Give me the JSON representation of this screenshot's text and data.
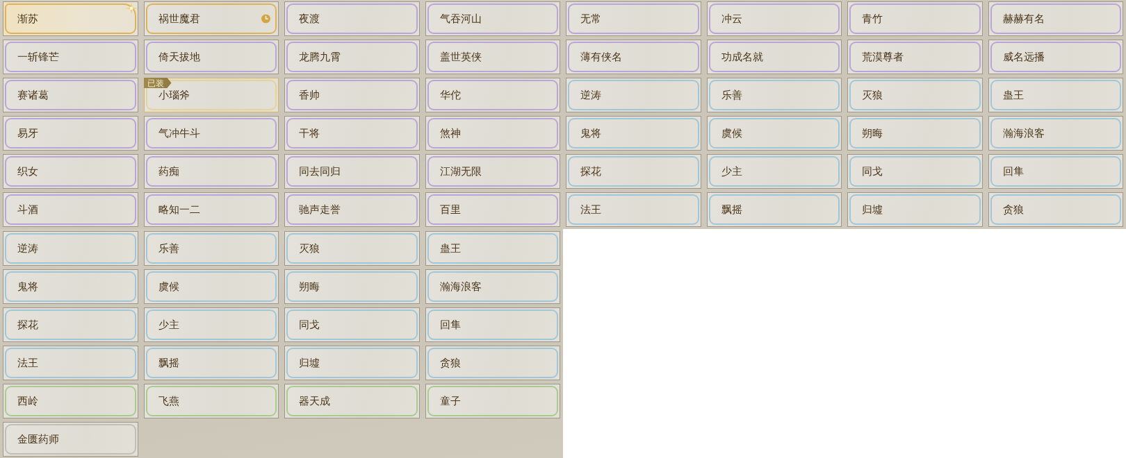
{
  "top_grid": {
    "titles": [
      {
        "name": "渐苏",
        "color": "#dfb25a",
        "kind": "special",
        "equipped": false
      },
      {
        "name": "祸世魔君",
        "color": "#dfb25a",
        "kind": "timed",
        "equipped": false
      },
      {
        "name": "夜渡",
        "color": "#b9a5d9",
        "kind": "plain",
        "equipped": false
      },
      {
        "name": "气吞河山",
        "color": "#b9a5d9",
        "kind": "plain",
        "equipped": false
      },
      {
        "name": "无常",
        "color": "#b9a5d9",
        "kind": "plain",
        "equipped": false
      },
      {
        "name": "冲云",
        "color": "#b9a5d9",
        "kind": "plain",
        "equipped": false
      },
      {
        "name": "青竹",
        "color": "#b9a5d9",
        "kind": "plain",
        "equipped": false
      },
      {
        "name": "赫赫有名",
        "color": "#b9a5d9",
        "kind": "plain",
        "equipped": false
      },
      {
        "name": "一斩锋芒",
        "color": "#b9a5d9",
        "kind": "plain",
        "equipped": false
      },
      {
        "name": "倚天拔地",
        "color": "#b9a5d9",
        "kind": "plain",
        "equipped": false
      },
      {
        "name": "龙腾九霄",
        "color": "#b9a5d9",
        "kind": "plain",
        "equipped": false
      },
      {
        "name": "盖世英侠",
        "color": "#b9a5d9",
        "kind": "plain",
        "equipped": false
      },
      {
        "name": "薄有侠名",
        "color": "#b9a5d9",
        "kind": "plain",
        "equipped": false
      },
      {
        "name": "功成名就",
        "color": "#b9a5d9",
        "kind": "plain",
        "equipped": false
      },
      {
        "name": "荒漠尊者",
        "color": "#b9a5d9",
        "kind": "plain",
        "equipped": false
      },
      {
        "name": "威名远播",
        "color": "#b9a5d9",
        "kind": "plain",
        "equipped": false
      },
      {
        "name": "赛诸葛",
        "color": "#b9a5d9",
        "kind": "plain",
        "equipped": false
      },
      {
        "name": "小瑙斧",
        "color": "#e6d398",
        "kind": "plain",
        "equipped": true,
        "badge": "已装"
      },
      {
        "name": "香帅",
        "color": "#b9a5d9",
        "kind": "plain",
        "equipped": false
      },
      {
        "name": "华佗",
        "color": "#b9a5d9",
        "kind": "plain",
        "equipped": false
      },
      {
        "name": "逆涛",
        "color": "#9fc7d9",
        "kind": "plain",
        "equipped": false
      },
      {
        "name": "乐善",
        "color": "#9fc7d9",
        "kind": "plain",
        "equipped": false
      },
      {
        "name": "灭狼",
        "color": "#9fc7d9",
        "kind": "plain",
        "equipped": false
      },
      {
        "name": "蛊王",
        "color": "#9fc7d9",
        "kind": "plain",
        "equipped": false
      },
      {
        "name": "易牙",
        "color": "#b9a5d9",
        "kind": "plain",
        "equipped": false
      },
      {
        "name": "气冲牛斗",
        "color": "#b9a5d9",
        "kind": "plain",
        "equipped": false
      },
      {
        "name": "干将",
        "color": "#b9a5d9",
        "kind": "plain",
        "equipped": false
      },
      {
        "name": "煞神",
        "color": "#b9a5d9",
        "kind": "plain",
        "equipped": false
      },
      {
        "name": "鬼将",
        "color": "#9fc7d9",
        "kind": "plain",
        "equipped": false
      },
      {
        "name": "虞候",
        "color": "#9fc7d9",
        "kind": "plain",
        "equipped": false
      },
      {
        "name": "朔晦",
        "color": "#9fc7d9",
        "kind": "plain",
        "equipped": false
      },
      {
        "name": "瀚海浪客",
        "color": "#9fc7d9",
        "kind": "plain",
        "equipped": false
      },
      {
        "name": "织女",
        "color": "#b9a5d9",
        "kind": "plain",
        "equipped": false
      },
      {
        "name": "药痴",
        "color": "#b9a5d9",
        "kind": "plain",
        "equipped": false
      },
      {
        "name": "同去同归",
        "color": "#b9a5d9",
        "kind": "plain",
        "equipped": false
      },
      {
        "name": "江湖无限",
        "color": "#b9a5d9",
        "kind": "plain",
        "equipped": false
      },
      {
        "name": "探花",
        "color": "#9fc7d9",
        "kind": "plain",
        "equipped": false
      },
      {
        "name": "少主",
        "color": "#9fc7d9",
        "kind": "plain",
        "equipped": false
      },
      {
        "name": "同戈",
        "color": "#9fc7d9",
        "kind": "plain",
        "equipped": false
      },
      {
        "name": "回隼",
        "color": "#9fc7d9",
        "kind": "plain",
        "equipped": false
      },
      {
        "name": "斗酒",
        "color": "#b9a5d9",
        "kind": "plain",
        "equipped": false
      },
      {
        "name": "略知一二",
        "color": "#b9a5d9",
        "kind": "plain",
        "equipped": false
      },
      {
        "name": "驰声走誉",
        "color": "#b9a5d9",
        "kind": "plain",
        "equipped": false
      },
      {
        "name": "百里",
        "color": "#b9a5d9",
        "kind": "plain",
        "equipped": false
      },
      {
        "name": "法王",
        "color": "#9fc7d9",
        "kind": "plain",
        "equipped": false
      },
      {
        "name": "飘摇",
        "color": "#9fc7d9",
        "kind": "plain",
        "equipped": false
      },
      {
        "name": "归墟",
        "color": "#9fc7d9",
        "kind": "plain",
        "equipped": false
      },
      {
        "name": "贪狼",
        "color": "#9fc7d9",
        "kind": "plain",
        "equipped": false
      }
    ]
  },
  "bottom_grid": {
    "titles": [
      {
        "name": "逆涛",
        "color": "#9fc7d9",
        "kind": "plain",
        "equipped": false
      },
      {
        "name": "乐善",
        "color": "#9fc7d9",
        "kind": "plain",
        "equipped": false
      },
      {
        "name": "灭狼",
        "color": "#9fc7d9",
        "kind": "plain",
        "equipped": false
      },
      {
        "name": "蛊王",
        "color": "#9fc7d9",
        "kind": "plain",
        "equipped": false
      },
      {
        "name": "鬼将",
        "color": "#9fc7d9",
        "kind": "plain",
        "equipped": false
      },
      {
        "name": "虞候",
        "color": "#9fc7d9",
        "kind": "plain",
        "equipped": false
      },
      {
        "name": "朔晦",
        "color": "#9fc7d9",
        "kind": "plain",
        "equipped": false
      },
      {
        "name": "瀚海浪客",
        "color": "#9fc7d9",
        "kind": "plain",
        "equipped": false
      },
      {
        "name": "探花",
        "color": "#9fc7d9",
        "kind": "plain",
        "equipped": false
      },
      {
        "name": "少主",
        "color": "#9fc7d9",
        "kind": "plain",
        "equipped": false
      },
      {
        "name": "同戈",
        "color": "#9fc7d9",
        "kind": "plain",
        "equipped": false
      },
      {
        "name": "回隼",
        "color": "#9fc7d9",
        "kind": "plain",
        "equipped": false
      },
      {
        "name": "法王",
        "color": "#9fc7d9",
        "kind": "plain",
        "equipped": false
      },
      {
        "name": "飘摇",
        "color": "#9fc7d9",
        "kind": "plain",
        "equipped": false
      },
      {
        "name": "归墟",
        "color": "#9fc7d9",
        "kind": "plain",
        "equipped": false
      },
      {
        "name": "贪狼",
        "color": "#9fc7d9",
        "kind": "plain",
        "equipped": false
      },
      {
        "name": "西岭",
        "color": "#a9cb8f",
        "kind": "plain",
        "equipped": false
      },
      {
        "name": "飞燕",
        "color": "#a9cb8f",
        "kind": "plain",
        "equipped": false
      },
      {
        "name": "器天成",
        "color": "#a9cb8f",
        "kind": "plain",
        "equipped": false
      },
      {
        "name": "童子",
        "color": "#a9cb8f",
        "kind": "plain",
        "equipped": false
      },
      {
        "name": "金匮药师",
        "color": "#c2beb5",
        "kind": "plain",
        "equipped": false
      }
    ]
  }
}
